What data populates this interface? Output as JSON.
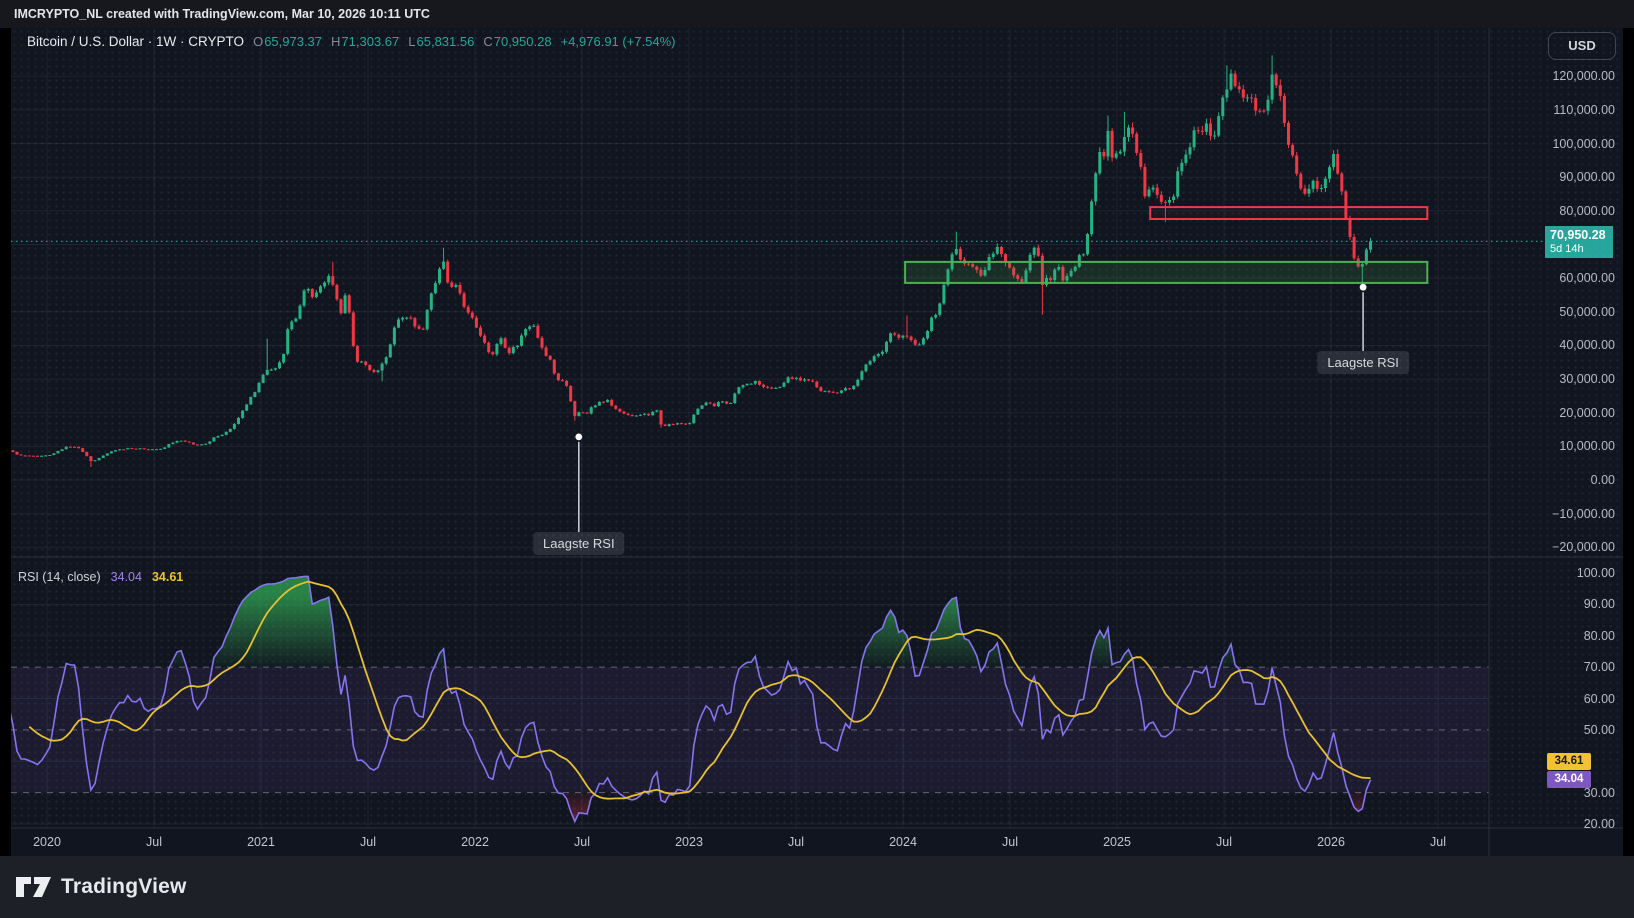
{
  "watermark": {
    "text": "IMCRYPTO_NL created with TradingView.com, Mar 10, 2026 10:11 UTC"
  },
  "symbol_bar": {
    "title": "Bitcoin / U.S. Dollar · 1W · CRYPTO",
    "fields": [
      {
        "label": "O",
        "value": "65,973.37"
      },
      {
        "label": "H",
        "value": "71,303.67"
      },
      {
        "label": "L",
        "value": "65,831.56"
      },
      {
        "label": "C",
        "value": "70,950.28"
      }
    ],
    "change": "+4,976.91 (+7.54%)"
  },
  "currency_button": {
    "label": "USD"
  },
  "price_scale_badge": {
    "price": "70,950.28",
    "countdown": "5d 14h"
  },
  "rsi_header": {
    "title": "RSI (14, close)",
    "rsi_value": "34.04",
    "ma_value": "34.61"
  },
  "rsi_scale_badges": {
    "ma": "34.61",
    "rsi": "34.04"
  },
  "footer": {
    "brand": "TradingView"
  },
  "price_axis_labels": [
    {
      "text": "120,000.00",
      "value": 120000
    },
    {
      "text": "110,000.00",
      "value": 110000
    },
    {
      "text": "100,000.00",
      "value": 100000
    },
    {
      "text": "90,000.00",
      "value": 90000
    },
    {
      "text": "80,000.00",
      "value": 80000
    },
    {
      "text": "60,000.00",
      "value": 60000
    },
    {
      "text": "50,000.00",
      "value": 50000
    },
    {
      "text": "40,000.00",
      "value": 40000
    },
    {
      "text": "30,000.00",
      "value": 30000
    },
    {
      "text": "20,000.00",
      "value": 20000
    },
    {
      "text": "10,000.00",
      "value": 10000
    },
    {
      "text": "0.00",
      "value": 0
    },
    {
      "text": "−10,000.00",
      "value": -10000
    },
    {
      "text": "−20,000.00",
      "value": -20000
    }
  ],
  "rsi_axis_labels": [
    {
      "text": "100.00",
      "value": 100
    },
    {
      "text": "90.00",
      "value": 90
    },
    {
      "text": "80.00",
      "value": 80
    },
    {
      "text": "70.00",
      "value": 70
    },
    {
      "text": "60.00",
      "value": 60
    },
    {
      "text": "50.00",
      "value": 50
    },
    {
      "text": "30.00",
      "value": 30
    },
    {
      "text": "20.00",
      "value": 20
    }
  ],
  "time_axis_labels": [
    {
      "text": "2020",
      "t": 2020.0
    },
    {
      "text": "Jul",
      "t": 2020.5
    },
    {
      "text": "2021",
      "t": 2021.0
    },
    {
      "text": "Jul",
      "t": 2021.5
    },
    {
      "text": "2022",
      "t": 2022.0
    },
    {
      "text": "Jul",
      "t": 2022.5
    },
    {
      "text": "2023",
      "t": 2023.0
    },
    {
      "text": "Jul",
      "t": 2023.5
    },
    {
      "text": "2024",
      "t": 2024.0
    },
    {
      "text": "Jul",
      "t": 2024.5
    },
    {
      "text": "2025",
      "t": 2025.0
    },
    {
      "text": "Jul",
      "t": 2025.5
    },
    {
      "text": "2026",
      "t": 2026.0
    },
    {
      "text": "Jul",
      "t": 2026.5
    }
  ],
  "colors": {
    "up": "#24b283",
    "down": "#f23645",
    "last_price": "#26a69a",
    "rsi_line": "#8673f0",
    "rsi_ma": "#e7c12f",
    "band": "#7e57c2",
    "box_red": "#f23645",
    "box_green": "#4caf50",
    "marker": "#cfd3dc",
    "over_fill": "#2e9e50",
    "under_fill": "#f23645"
  },
  "chart_data": {
    "type": "candlestick",
    "symbol": "Bitcoin / U.S. Dollar",
    "interval": "1W",
    "exchange": "CRYPTO",
    "last_bar": {
      "open": 65973.37,
      "high": 71303.67,
      "low": 65831.56,
      "close": 70950.28,
      "change": 4976.91,
      "change_pct": 7.54
    },
    "last_close": 70950.28,
    "price_axis": {
      "min": -20000,
      "max": 120000,
      "step": 10000
    },
    "rsi_axis": {
      "min": 20,
      "max": 100
    },
    "time_axis": {
      "start": 2019.75,
      "end": 2026.58,
      "tick_months": 6
    },
    "price_anchors": [
      [
        2019.4,
        7900
      ],
      [
        2019.5,
        10900
      ],
      [
        2019.56,
        10300
      ],
      [
        2019.62,
        9500
      ],
      [
        2019.69,
        8200
      ],
      [
        2019.75,
        8300
      ],
      [
        2019.81,
        9200
      ],
      [
        2019.87,
        7300
      ],
      [
        2019.94,
        7200
      ],
      [
        2020.0,
        7300
      ],
      [
        2020.04,
        8100
      ],
      [
        2020.08,
        9600
      ],
      [
        2020.12,
        10200
      ],
      [
        2020.16,
        8900
      ],
      [
        2020.21,
        5300
      ],
      [
        2020.25,
        6800
      ],
      [
        2020.31,
        8800
      ],
      [
        2020.38,
        9500
      ],
      [
        2020.46,
        9150
      ],
      [
        2020.54,
        9200
      ],
      [
        2020.58,
        11100
      ],
      [
        2020.63,
        11700
      ],
      [
        2020.69,
        10400
      ],
      [
        2020.75,
        10700
      ],
      [
        2020.79,
        13100
      ],
      [
        2020.83,
        13800
      ],
      [
        2020.87,
        16100
      ],
      [
        2020.9,
        18700
      ],
      [
        2020.94,
        23300
      ],
      [
        2020.98,
        26500
      ],
      [
        2021.02,
        33500
      ],
      [
        2021.06,
        32100
      ],
      [
        2021.1,
        36000
      ],
      [
        2021.13,
        46300
      ],
      [
        2021.17,
        48600
      ],
      [
        2021.21,
        57400
      ],
      [
        2021.25,
        54100
      ],
      [
        2021.29,
        58900
      ],
      [
        2021.33,
        60000
      ],
      [
        2021.37,
        49000
      ],
      [
        2021.4,
        56400
      ],
      [
        2021.44,
        35600
      ],
      [
        2021.48,
        34700
      ],
      [
        2021.52,
        32200
      ],
      [
        2021.56,
        33500
      ],
      [
        2021.6,
        39200
      ],
      [
        2021.63,
        47100
      ],
      [
        2021.67,
        48900
      ],
      [
        2021.71,
        47200
      ],
      [
        2021.75,
        43200
      ],
      [
        2021.79,
        54700
      ],
      [
        2021.83,
        61300
      ],
      [
        2021.85,
        65500
      ],
      [
        2021.88,
        56500
      ],
      [
        2021.92,
        57300
      ],
      [
        2021.96,
        50100
      ],
      [
        2022.0,
        46300
      ],
      [
        2022.04,
        41600
      ],
      [
        2022.08,
        36900
      ],
      [
        2022.12,
        42400
      ],
      [
        2022.15,
        37800
      ],
      [
        2022.19,
        39400
      ],
      [
        2022.23,
        44500
      ],
      [
        2022.27,
        46800
      ],
      [
        2022.31,
        39700
      ],
      [
        2022.35,
        36000
      ],
      [
        2022.38,
        30100
      ],
      [
        2022.42,
        29000
      ],
      [
        2022.44,
        26700
      ],
      [
        2022.46,
        19000
      ],
      [
        2022.5,
        20500
      ],
      [
        2022.52,
        19200
      ],
      [
        2022.54,
        21500
      ],
      [
        2022.58,
        23300
      ],
      [
        2022.62,
        23800
      ],
      [
        2022.65,
        21300
      ],
      [
        2022.69,
        20000
      ],
      [
        2022.73,
        18900
      ],
      [
        2022.77,
        19500
      ],
      [
        2022.81,
        19200
      ],
      [
        2022.85,
        20700
      ],
      [
        2022.87,
        16300
      ],
      [
        2022.9,
        16500
      ],
      [
        2022.96,
        16800
      ],
      [
        2023.0,
        16600
      ],
      [
        2023.04,
        21100
      ],
      [
        2023.08,
        23000
      ],
      [
        2023.12,
        21800
      ],
      [
        2023.15,
        23500
      ],
      [
        2023.19,
        22400
      ],
      [
        2023.23,
        27500
      ],
      [
        2023.27,
        28500
      ],
      [
        2023.31,
        29400
      ],
      [
        2023.35,
        27600
      ],
      [
        2023.38,
        26900
      ],
      [
        2023.42,
        27100
      ],
      [
        2023.46,
        30700
      ],
      [
        2023.5,
        30300
      ],
      [
        2023.54,
        29900
      ],
      [
        2023.58,
        29200
      ],
      [
        2023.62,
        26000
      ],
      [
        2023.67,
        26100
      ],
      [
        2023.71,
        26600
      ],
      [
        2023.75,
        27000
      ],
      [
        2023.79,
        29900
      ],
      [
        2023.83,
        34500
      ],
      [
        2023.87,
        37100
      ],
      [
        2023.9,
        37800
      ],
      [
        2023.94,
        43700
      ],
      [
        2023.98,
        42300
      ],
      [
        2024.02,
        42600
      ],
      [
        2024.06,
        40000
      ],
      [
        2024.1,
        42000
      ],
      [
        2024.13,
        47700
      ],
      [
        2024.17,
        51700
      ],
      [
        2024.21,
        62500
      ],
      [
        2024.25,
        69000
      ],
      [
        2024.29,
        64000
      ],
      [
        2024.33,
        63800
      ],
      [
        2024.37,
        60800
      ],
      [
        2024.4,
        66300
      ],
      [
        2024.44,
        69300
      ],
      [
        2024.48,
        64300
      ],
      [
        2024.52,
        60900
      ],
      [
        2024.56,
        58200
      ],
      [
        2024.6,
        68300
      ],
      [
        2024.63,
        67100
      ],
      [
        2024.65,
        58100
      ],
      [
        2024.69,
        59400
      ],
      [
        2024.73,
        63600
      ],
      [
        2024.75,
        57900
      ],
      [
        2024.79,
        63200
      ],
      [
        2024.83,
        66600
      ],
      [
        2024.85,
        69000
      ],
      [
        2024.87,
        76500
      ],
      [
        2024.9,
        91000
      ],
      [
        2024.92,
        97700
      ],
      [
        2024.94,
        95800
      ],
      [
        2024.96,
        104400
      ],
      [
        2024.98,
        94300
      ],
      [
        2025.02,
        98600
      ],
      [
        2025.04,
        104800
      ],
      [
        2025.08,
        102700
      ],
      [
        2025.1,
        96100
      ],
      [
        2025.13,
        84300
      ],
      [
        2025.17,
        86800
      ],
      [
        2025.19,
        84400
      ],
      [
        2025.23,
        82600
      ],
      [
        2025.27,
        85200
      ],
      [
        2025.29,
        94700
      ],
      [
        2025.33,
        97000
      ],
      [
        2025.35,
        103800
      ],
      [
        2025.38,
        103700
      ],
      [
        2025.42,
        105600
      ],
      [
        2025.46,
        101600
      ],
      [
        2025.48,
        108200
      ],
      [
        2025.52,
        117400
      ],
      [
        2025.54,
        119000
      ],
      [
        2025.58,
        117500
      ],
      [
        2025.6,
        114800
      ],
      [
        2025.63,
        113500
      ],
      [
        2025.65,
        108800
      ],
      [
        2025.69,
        109700
      ],
      [
        2025.71,
        115800
      ],
      [
        2025.73,
        120300
      ],
      [
        2025.75,
        114600
      ],
      [
        2025.77,
        110500
      ],
      [
        2025.79,
        105200
      ],
      [
        2025.81,
        96500
      ],
      [
        2025.83,
        94100
      ],
      [
        2025.85,
        86600
      ],
      [
        2025.87,
        83500
      ],
      [
        2025.9,
        87300
      ],
      [
        2025.92,
        90100
      ],
      [
        2025.94,
        87100
      ],
      [
        2025.96,
        88500
      ],
      [
        2025.98,
        91000
      ],
      [
        2026.0,
        96400
      ],
      [
        2026.02,
        94200
      ],
      [
        2026.04,
        88900
      ],
      [
        2026.06,
        80100
      ],
      [
        2026.08,
        76300
      ],
      [
        2026.1,
        67800
      ],
      [
        2026.125,
        63500
      ],
      [
        2026.15,
        64500
      ],
      [
        2026.17,
        68400
      ],
      [
        2026.19,
        70950
      ]
    ],
    "wick_overrides": [
      {
        "t": 2020.21,
        "low": 3850
      },
      {
        "t": 2021.02,
        "high": 42000
      },
      {
        "t": 2021.33,
        "high": 64850
      },
      {
        "t": 2021.56,
        "low": 29300
      },
      {
        "t": 2021.85,
        "high": 69000
      },
      {
        "t": 2022.46,
        "low": 17600
      },
      {
        "t": 2022.87,
        "low": 15500
      },
      {
        "t": 2024.02,
        "high": 48900
      },
      {
        "t": 2024.25,
        "high": 73800
      },
      {
        "t": 2024.65,
        "low": 49100
      },
      {
        "t": 2024.96,
        "high": 108300
      },
      {
        "t": 2025.04,
        "high": 109400
      },
      {
        "t": 2025.23,
        "low": 76600
      },
      {
        "t": 2025.52,
        "high": 123200
      },
      {
        "t": 2025.73,
        "high": 126200
      },
      {
        "t": 2026.15,
        "low": 58800
      }
    ],
    "boxes": [
      {
        "name": "resistance-zone",
        "t0": 2025.155,
        "t1": 2026.45,
        "price_top": 81100,
        "price_bottom": 77550,
        "color": "red"
      },
      {
        "name": "support-zone",
        "t0": 2024.01,
        "t1": 2026.45,
        "price_top": 64800,
        "price_bottom": 58550,
        "color": "green"
      }
    ],
    "markers": [
      {
        "t": 2022.485,
        "price": 12800,
        "label": "Laagste RSI"
      },
      {
        "t": 2026.15,
        "price": 57300,
        "label": "Laagste RSI"
      }
    ],
    "rsi": {
      "period": 14,
      "ma_period": 14,
      "last": 34.04,
      "ma_last": 34.61,
      "band": [
        30,
        70
      ],
      "dashed_levels": [
        70,
        50,
        30
      ]
    }
  }
}
